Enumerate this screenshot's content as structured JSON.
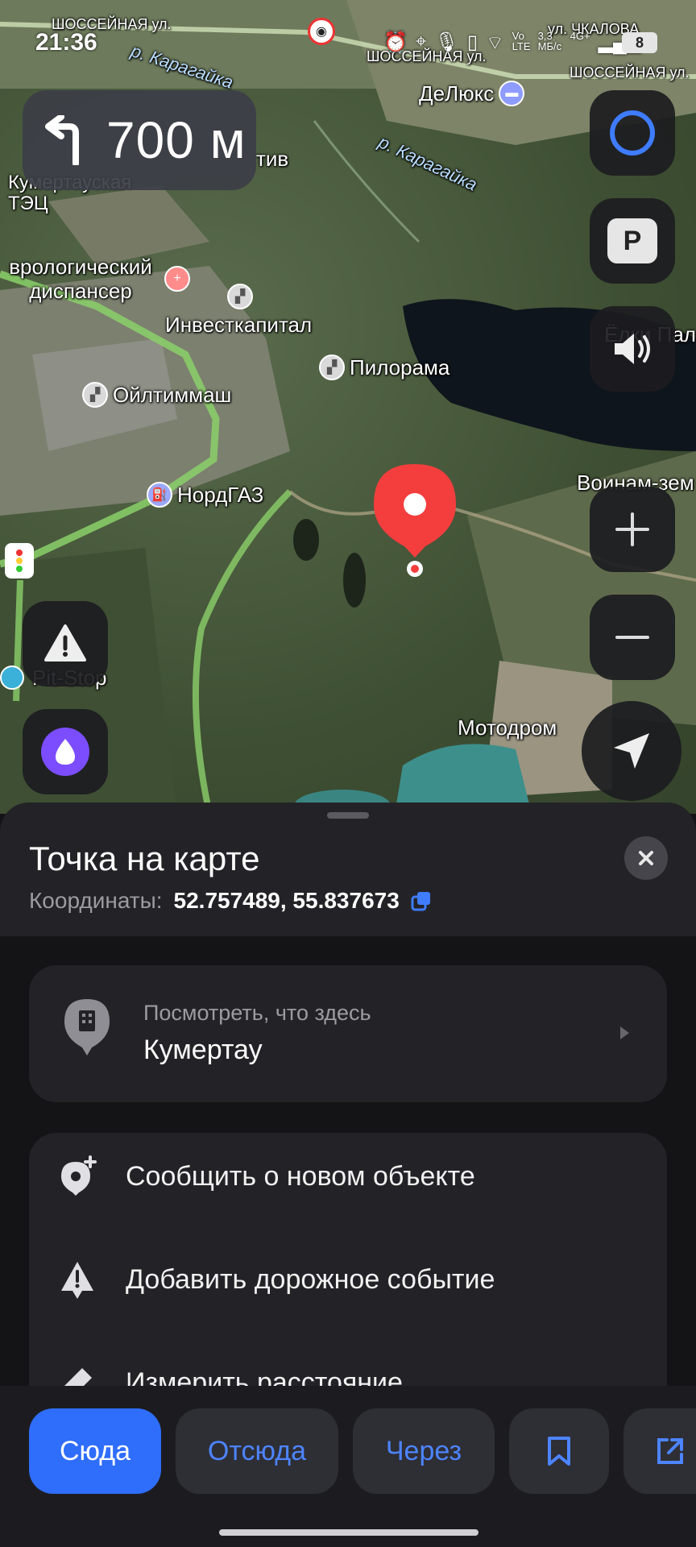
{
  "status_bar": {
    "time": "21:36",
    "icons": [
      "alarm-icon",
      "location-icon",
      "mic-icon",
      "vibrate-icon",
      "wifi-icon",
      "signal-icon"
    ],
    "net_labels": [
      "Vo LTE",
      "3,3 МБ/с",
      "4G+"
    ],
    "battery": "8"
  },
  "navigation": {
    "turn_direction": "left",
    "distance": "700 м"
  },
  "map": {
    "labels": {
      "street1": "ШОССЕЙНАЯ ул.",
      "street2": "ШОССЕЙНАЯ ул.",
      "street3": "ШОССЕЙНАЯ ул.",
      "street_chkalova": "ул. ЧКАЛОВА",
      "river1": "р. Карагайка",
      "river2": "р. Карагайка",
      "teс": "Кумертауская ТЭЦ",
      "dispanser": "врологический диспансер",
      "investkapital": "Инвесткапитал",
      "pilorama": "Пилорама",
      "oiltimmash": "Ойлтиммаш",
      "nordgaz": "НордГАЗ",
      "delux": "ДеЛюкс",
      "elki": "Ёлки Пал",
      "voinam": "Воинам-зем",
      "pitstop": "Pit-Stop",
      "motodrom": "Мотодром",
      "tiv": "тив"
    }
  },
  "map_controls": {
    "parking_label": "P"
  },
  "sheet": {
    "title": "Точка на карте",
    "coords_label": "Координаты:",
    "coords_value": "52.757489, 55.837673",
    "whats_here": {
      "subtitle": "Посмотреть, что здесь",
      "place": "Кумертау"
    },
    "actions": [
      {
        "label": "Сообщить о новом объекте",
        "icon": "add-place-icon"
      },
      {
        "label": "Добавить дорожное событие",
        "icon": "road-warning-icon"
      },
      {
        "label": "Измерить расстояние",
        "icon": "ruler-icon"
      }
    ]
  },
  "bottom_nav": {
    "here": "Сюда",
    "from": "Отсюда",
    "via": "Через",
    "bookmark_icon": "bookmark-icon",
    "share_icon": "share-icon"
  },
  "colors": {
    "accent_blue": "#2f6dfb",
    "link_blue": "#4d84ff",
    "pin_red": "#f43e3e",
    "alice_purple": "#7b4dff"
  }
}
